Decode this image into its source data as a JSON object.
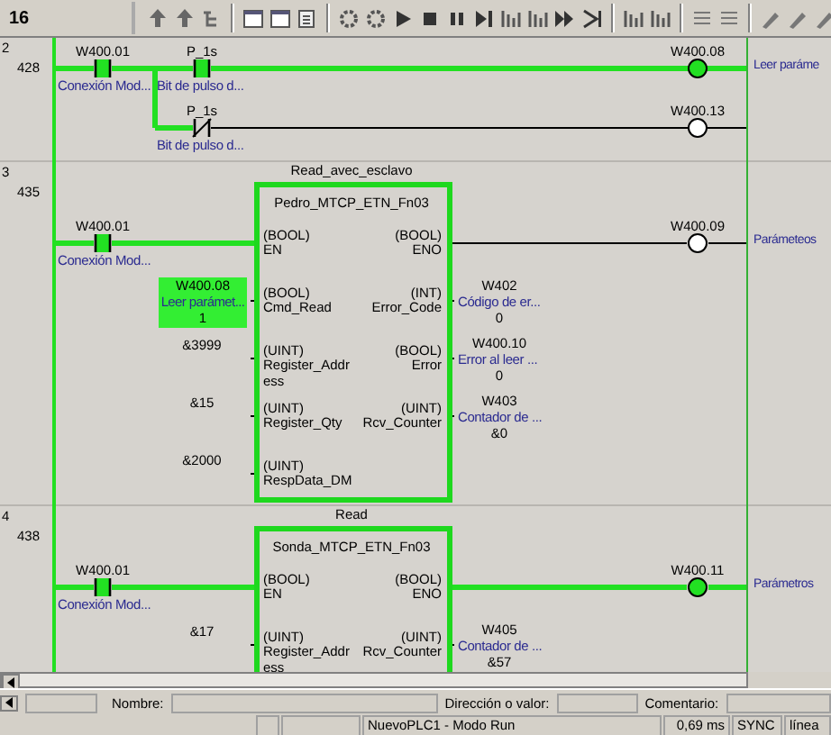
{
  "toolbar": {
    "zoom_label": "16"
  },
  "rungs": [
    {
      "number": "2",
      "step": "428",
      "comment": "Leer paráme",
      "contacts": [
        {
          "kind": "open",
          "address": "W400.01",
          "comment": "Conexión Mod...",
          "energized": true
        },
        {
          "kind": "open",
          "address": "P_1s",
          "comment": "Bit de pulso d...",
          "energized": true
        },
        {
          "kind": "closed",
          "address": "P_1s",
          "comment": "Bit de pulso d...",
          "energized": false
        }
      ],
      "coils": [
        {
          "address": "W400.08",
          "energized": true
        },
        {
          "address": "W400.13",
          "energized": false
        }
      ]
    },
    {
      "number": "3",
      "step": "435",
      "comment": "Parámeteos",
      "contacts": [
        {
          "kind": "open",
          "address": "W400.01",
          "comment": "Conexión Mod...",
          "energized": true
        }
      ],
      "coils": [
        {
          "address": "W400.09",
          "energized": false
        }
      ],
      "block": {
        "instance": "Read_avec_esclavo",
        "name": "Pedro_MTCP_ETN_Fn03",
        "inputs": [
          {
            "type": "(BOOL)",
            "name": "EN"
          },
          {
            "type": "(BOOL)",
            "name": "Cmd_Read",
            "operand": {
              "address": "W400.08",
              "comment": "Leer parámet...",
              "value": "1",
              "energized": true
            }
          },
          {
            "type": "(UINT)",
            "name": "Register_Address",
            "operand": {
              "value": "&3999"
            }
          },
          {
            "type": "(UINT)",
            "name": "Register_Qty",
            "operand": {
              "value": "&15"
            }
          },
          {
            "type": "(UINT)",
            "name": "RespData_DM",
            "operand": {
              "value": "&2000"
            }
          }
        ],
        "outputs": [
          {
            "type": "(BOOL)",
            "name": "ENO"
          },
          {
            "type": "(INT)",
            "name": "Error_Code",
            "operand": {
              "address": "W402",
              "comment": "Código de er...",
              "value": "0"
            }
          },
          {
            "type": "(BOOL)",
            "name": "Error",
            "operand": {
              "address": "W400.10",
              "comment": "Error al leer ...",
              "value": "0"
            }
          },
          {
            "type": "(UINT)",
            "name": "Rcv_Counter",
            "operand": {
              "address": "W403",
              "comment": "Contador de ...",
              "value": "&0"
            }
          }
        ]
      }
    },
    {
      "number": "4",
      "step": "438",
      "comment": "Parámetros",
      "contacts": [
        {
          "kind": "open",
          "address": "W400.01",
          "comment": "Conexión Mod...",
          "energized": true
        }
      ],
      "coils": [
        {
          "address": "W400.11",
          "energized": true
        }
      ],
      "block": {
        "instance": "Read",
        "name": "Sonda_MTCP_ETN_Fn03",
        "inputs": [
          {
            "type": "(BOOL)",
            "name": "EN"
          },
          {
            "type": "(UINT)",
            "name": "Register_Address",
            "operand": {
              "value": "&17"
            }
          }
        ],
        "outputs": [
          {
            "type": "(BOOL)",
            "name": "ENO"
          },
          {
            "type": "(UINT)",
            "name": "Rcv_Counter",
            "operand": {
              "address": "W405",
              "comment": "Contador de ...",
              "value": "&57"
            }
          }
        ]
      }
    }
  ],
  "fields": {
    "name_label": "Nombre:",
    "address_label": "Dirección o valor:",
    "comment_label": "Comentario:"
  },
  "status_bar": {
    "mode": "NuevoPLC1 - Modo Run",
    "cycle_time": "0,69 ms",
    "sync": "SYNC",
    "line": "línea"
  }
}
